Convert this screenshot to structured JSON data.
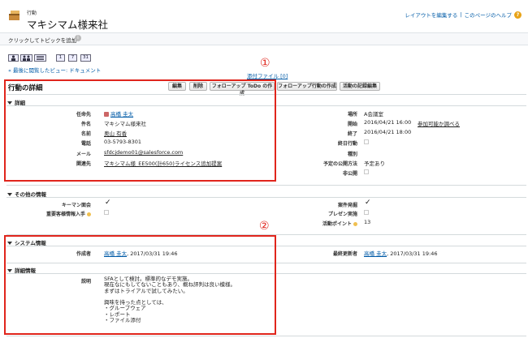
{
  "header": {
    "object_label": "行動",
    "title": "マキシマム様来社",
    "links": [
      "レイアウトを編集する",
      "このページのヘルプ"
    ],
    "separator": "|",
    "help_icon_glyph": "?"
  },
  "topic": {
    "link": "クリックしてトピックを追加",
    "info_glyph": "i"
  },
  "toolbar": {
    "icons": [
      "user-icon",
      "users-icon",
      "list-icon",
      "calendar-1-icon",
      "calendar-7-icon",
      "calendar-31-icon"
    ],
    "icon_texts": [
      "",
      "",
      "",
      "1",
      "7",
      "31"
    ],
    "recent_link": "« 最後に閲覧したビュー: ドキュメント"
  },
  "markers": [
    "①",
    "②"
  ],
  "attach_link": "添付ファイル [0]",
  "detail": {
    "title": "行動の詳細",
    "buttons": [
      "編集",
      "削除",
      "フォローアップ ToDo の作成",
      "フォローアップ行動の作成",
      "活動の記録編集"
    ]
  },
  "sections": {
    "shousai": "詳細",
    "sonota": "その他の情報",
    "system": "システム情報",
    "detail_info": "詳細情報"
  },
  "fields_left": [
    {
      "label": "任命先",
      "value": "高橋 圭太"
    },
    {
      "label": "件名",
      "value": "マキシマム様来社"
    },
    {
      "label": "名前",
      "value": "奥山 有香"
    },
    {
      "label": "電話",
      "value": "03-5793-8301"
    },
    {
      "label": "メール",
      "value": "sfdcjdemo01@salesforce.com"
    },
    {
      "label": "関連先",
      "value": "マキシマム様_EE500(計650)ライセンス追加提案"
    }
  ],
  "fields_right": [
    {
      "label": "場所",
      "value": "A会議室"
    },
    {
      "label": "開始",
      "value": "2016/04/21 16:00",
      "extra": "参加可能か調べる"
    },
    {
      "label": "終了",
      "value": "2016/04/21 18:00"
    },
    {
      "label": "終日行動",
      "value": ""
    },
    {
      "label": "種別",
      "value": ""
    },
    {
      "label": "予定の公開方法",
      "value": "予定あり"
    },
    {
      "label": "非公開",
      "value": ""
    }
  ],
  "other": {
    "keyman_label": "キーマン面会",
    "keyman_checked": true,
    "juyo_label": "重要客様情報入手",
    "anken_label": "案件発掘",
    "anken_checked": true,
    "presen_label": "プレゼン実施",
    "point_label": "活動ポイント",
    "point_value": "13",
    "check_glyph": "✓"
  },
  "system": {
    "created_label": "作成者",
    "created_user": "高橋 圭太",
    "created_date": ", 2017/03/31 19:46",
    "modified_label": "最終更新者",
    "modified_user": "高橋 圭太",
    "modified_date": ", 2017/03/31 19:46"
  },
  "description": {
    "label": "説明",
    "text": "SFAとして検討。標準的なデモ実施。\n現在なにもしてないこともあり、概ね評判は良い模様。\nまずはトライアルで試してみたい。\n\n興味を持った点としては、\n・グループウェア\n・レポート\n・ファイル添付"
  },
  "colors": {
    "highlight": "#e0251c",
    "link": "#015ba7"
  }
}
